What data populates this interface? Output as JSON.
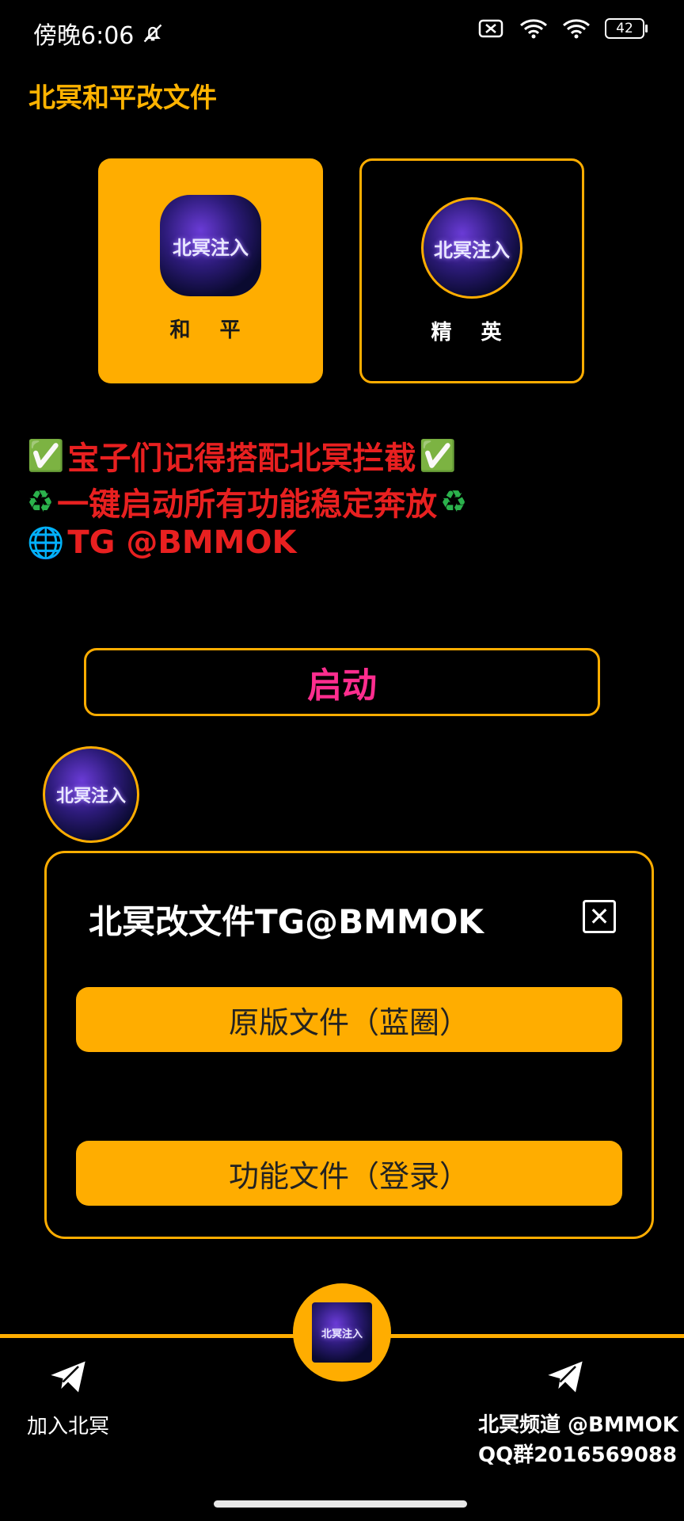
{
  "status": {
    "time": "傍晚6:06",
    "battery": "42"
  },
  "app": {
    "title": "北冥和平改文件"
  },
  "modes": [
    {
      "label": "和 平",
      "logo_text": "北冥注入"
    },
    {
      "label": "精 英",
      "logo_text": "北冥注入"
    }
  ],
  "promo": {
    "line1": "宝子们记得搭配北冥拦截",
    "line2": "一键启动所有功能稳定奔放",
    "line3": "TG @BMMOK"
  },
  "start_button": "启动",
  "float_logo_text": "北冥注入",
  "dialog": {
    "title": "北冥改文件TG@BMMOK",
    "buttons": [
      "原版文件（蓝圈）",
      "功能文件（登录）"
    ]
  },
  "nav": {
    "left_label": "加入北冥",
    "right_line1": "北冥频道 @BMMOK",
    "right_line2": "QQ群2016569088",
    "center_logo_text": "北冥注入"
  },
  "colors": {
    "accent": "#ffad00",
    "promo_red": "#e82020",
    "start_pink": "#ff2d8f"
  }
}
